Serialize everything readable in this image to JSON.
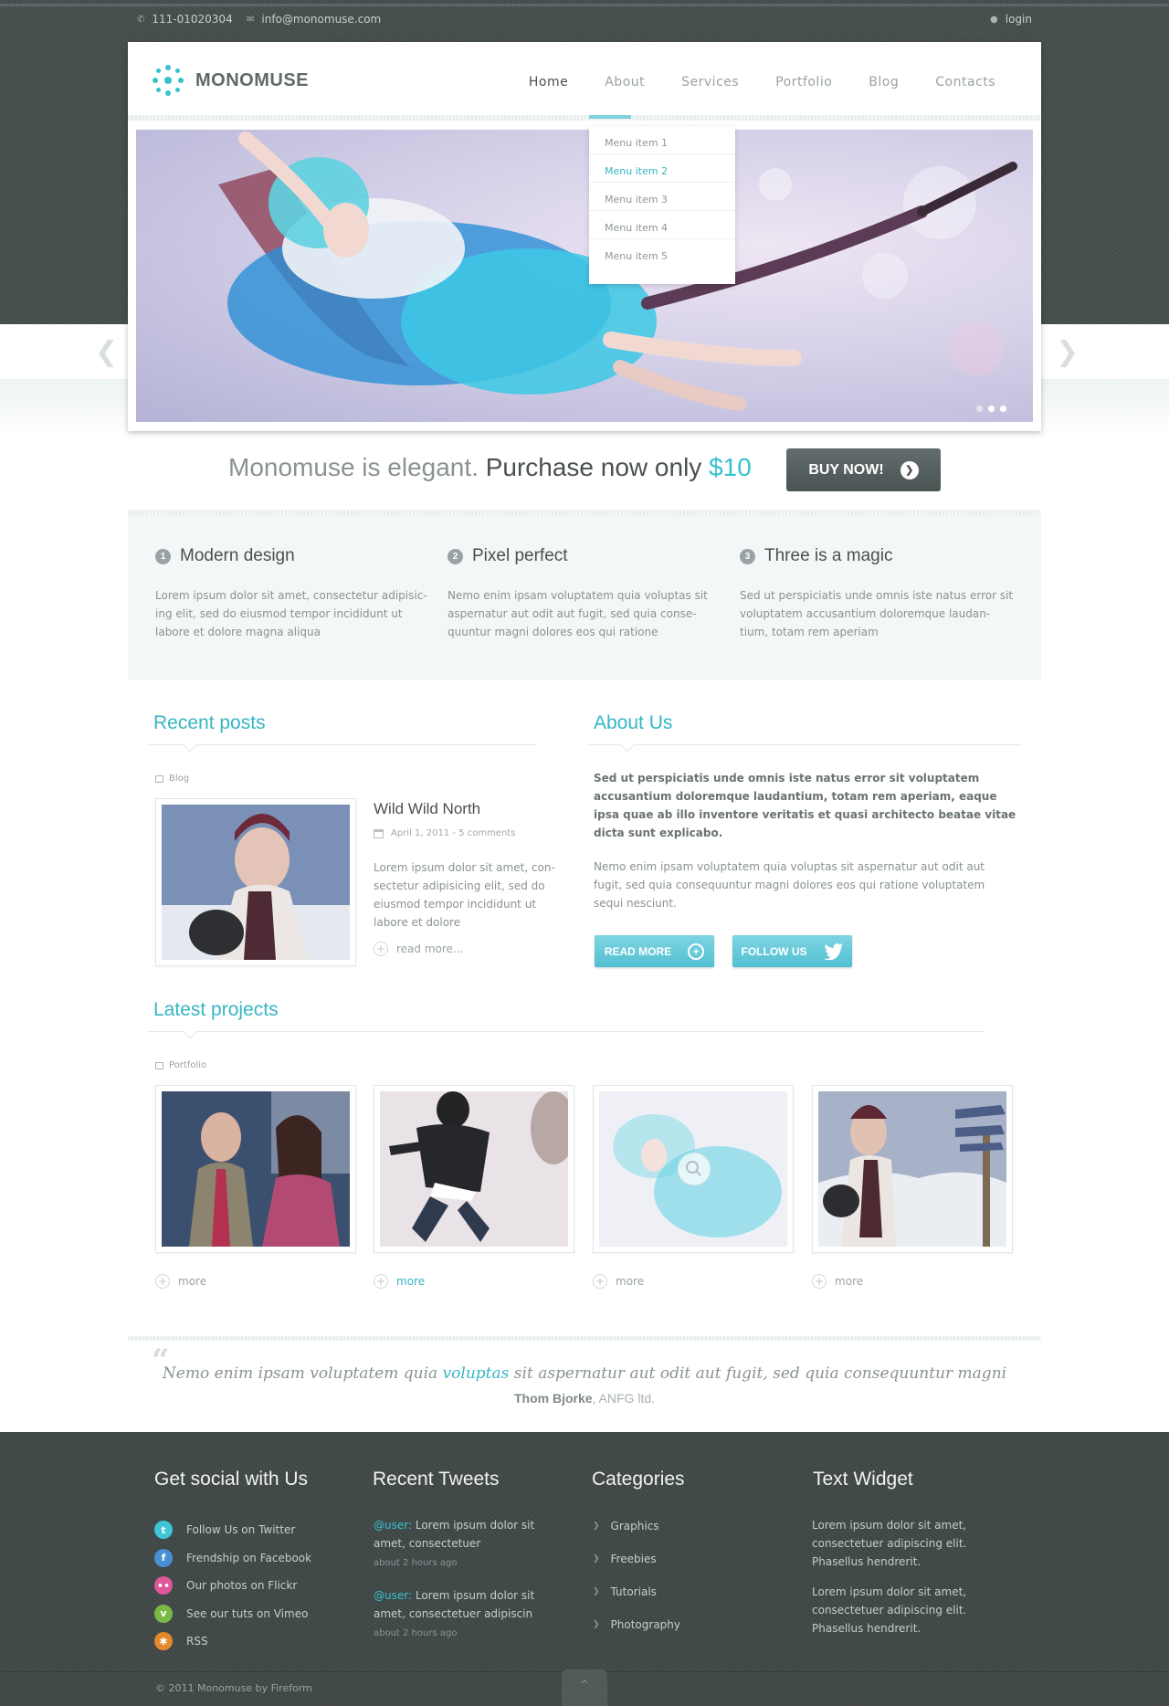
{
  "topbar": {
    "phone": "111-01020304",
    "email": "info@monomuse.com",
    "login": "login"
  },
  "brand": {
    "name": "MONOMUSE",
    "accent": "#36c1cf"
  },
  "nav": {
    "items": [
      "Home",
      "About",
      "Services",
      "Portfolio",
      "Blog",
      "Contacts"
    ],
    "active": "Home",
    "dropdown": [
      "Menu item 1",
      "Menu item 2",
      "Menu item 3",
      "Menu item 4",
      "Menu item 5"
    ],
    "dropdown_active": "Menu item 2"
  },
  "slider": {
    "dots_count": 3,
    "active_dot": 1,
    "prev_icon": "chevron-left-icon",
    "next_icon": "chevron-right-icon"
  },
  "promo": {
    "lead": "Monomuse is elegant.",
    "text": "Purchase now only",
    "price": "$10",
    "button": "BUY NOW!"
  },
  "features": [
    {
      "num": "1",
      "title": "Modern design",
      "text": "Lorem ipsum dolor sit amet, consectetur adipisic-ing elit, sed do eiusmod tempor incididunt ut labore et dolore magna aliqua"
    },
    {
      "num": "2",
      "title": "Pixel perfect",
      "text": "Nemo enim ipsam voluptatem quia voluptas sit aspernatur aut odit aut fugit, sed quia conse-quuntur magni dolores eos qui ratione"
    },
    {
      "num": "3",
      "title": "Three is a magic",
      "text": "Sed ut perspiciatis unde omnis iste natus error sit voluptatem accusantium doloremque laudan-tium, totam rem aperiam"
    }
  ],
  "recent_posts": {
    "heading": "Recent posts",
    "category": "Blog",
    "post": {
      "title": "Wild Wild North",
      "meta": "April 1, 2011 - 5 comments",
      "excerpt": "Lorem ipsum dolor sit amet, con-sectetur adipisicing elit, sed do eiusmod tempor incididunt ut labore et dolore",
      "read_more": "read more..."
    }
  },
  "about": {
    "heading": "About Us",
    "bold": "Sed ut perspiciatis unde omnis iste natus error sit voluptatem accusantium doloremque laudantium, totam rem aperiam, eaque ipsa quae ab illo inventore veritatis et quasi architecto beatae vitae dicta sunt explicabo.",
    "text": "Nemo enim ipsam voluptatem quia voluptas sit aspernatur aut odit aut fugit, sed quia consequuntur magni dolores eos qui ratione voluptatem sequi nesciunt.",
    "read_more": "READ MORE",
    "follow": "FOLLOW US"
  },
  "projects": {
    "heading": "Latest projects",
    "category": "Portfolio",
    "items": [
      {
        "more": "more"
      },
      {
        "more": "more"
      },
      {
        "more": "more"
      },
      {
        "more": "more"
      }
    ],
    "highlighted_index": 1
  },
  "quote": {
    "before": "Nemo enim ipsam voluptatem quia",
    "highlight": "voluptas",
    "after": "sit aspernatur aut odit aut fugit, sed quia consequuntur magni",
    "author": "Thom Bjorke",
    "company": ", ANFG ltd."
  },
  "footer": {
    "social": {
      "heading": "Get social with Us",
      "items": [
        {
          "label": "Follow Us on Twitter",
          "icon": "twitter-icon",
          "color": "#3ec6d6"
        },
        {
          "label": "Frendship on Facebook",
          "icon": "facebook-icon",
          "color": "#4a8fd6"
        },
        {
          "label": "Our photos on Flickr",
          "icon": "flickr-icon",
          "color": "#e0569a"
        },
        {
          "label": "See our tuts on Vimeo",
          "icon": "vimeo-icon",
          "color": "#7ab943"
        },
        {
          "label": "RSS",
          "icon": "rss-icon",
          "color": "#e58a2c"
        }
      ]
    },
    "tweets": {
      "heading": "Recent Tweets",
      "items": [
        {
          "user": "@user:",
          "text": "Lorem ipsum dolor sit amet, consectetuer",
          "time": "about 2 hours ago"
        },
        {
          "user": "@user:",
          "text": "Lorem ipsum dolor sit amet, consectetuer adipiscin",
          "time": "about 2 hours ago"
        }
      ]
    },
    "categories": {
      "heading": "Categories",
      "items": [
        "Graphics",
        "Freebies",
        "Tutorials",
        "Photography"
      ]
    },
    "widget": {
      "heading": "Text Widget",
      "paragraphs": [
        "Lorem ipsum dolor sit amet, consectetuer adipiscing elit. Phasellus hendrerit.",
        "Lorem ipsum dolor sit amet, consectetuer adipiscing elit. Phasellus hendrerit."
      ]
    },
    "copyright": "© 2011 Monomuse by Fireform"
  }
}
